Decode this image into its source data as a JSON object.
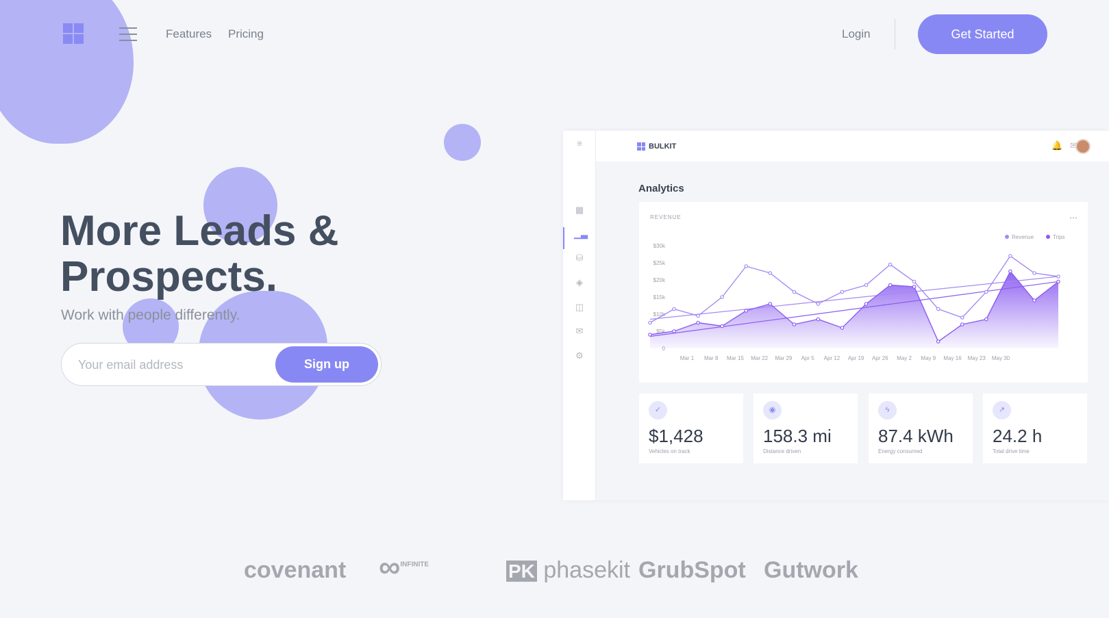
{
  "nav": {
    "links": [
      "Features",
      "Pricing"
    ],
    "login": "Login",
    "cta": "Get Started"
  },
  "hero": {
    "title_line1": "More Leads &",
    "title_line2": "Prospects.",
    "subtitle": "Work with people differently.",
    "email_placeholder": "Your email address",
    "signup": "Sign up"
  },
  "dashboard": {
    "brand": "BULKIT",
    "heading": "Analytics",
    "card_title": "REVENUE",
    "menu": "…",
    "stats": [
      {
        "icon": "check-icon",
        "glyph": "✓",
        "value": "$1,428",
        "label": "Vehicles on track"
      },
      {
        "icon": "location-pin-icon",
        "glyph": "◉",
        "value": "158.3 mi",
        "label": "Distance driven"
      },
      {
        "icon": "lightning-icon",
        "glyph": "ϟ",
        "value": "87.4 kWh",
        "label": "Energy consumed"
      },
      {
        "icon": "trend-icon",
        "glyph": "↗",
        "value": "24.2 h",
        "label": "Total drive time"
      }
    ]
  },
  "chart_data": {
    "type": "area",
    "title": "REVENUE",
    "categories": [
      "Mar 1",
      "Mar 8",
      "Mar 15",
      "Mar 22",
      "Mar 29",
      "Apr 5",
      "Apr 12",
      "Apr 19",
      "Apr 26",
      "May 2",
      "May 9",
      "May 16",
      "May 23",
      "May 30"
    ],
    "y_ticks": [
      "0",
      "$5k",
      "$10k",
      "$15k",
      "$20k",
      "$25k",
      "$30k"
    ],
    "ylim": [
      0,
      30000
    ],
    "legend_position": "top-right",
    "series": [
      {
        "name": "Revenue",
        "color": "#a48af4",
        "style": "line",
        "x": [
          0,
          1,
          2,
          3,
          4,
          5,
          6,
          7,
          8,
          9,
          10,
          11,
          12,
          13,
          14,
          15,
          16,
          17
        ],
        "values": [
          7500,
          11500,
          9500,
          15000,
          24000,
          22000,
          16500,
          13000,
          16500,
          18500,
          24500,
          19500,
          11500,
          9000,
          16500,
          27000,
          22000,
          21000
        ]
      },
      {
        "name": "Trips",
        "color": "#8a5cf0",
        "style": "area",
        "x": [
          0,
          1,
          2,
          3,
          4,
          5,
          6,
          7,
          8,
          9,
          10,
          11,
          12,
          13,
          14,
          15,
          16,
          17
        ],
        "values": [
          4000,
          5000,
          7500,
          6500,
          11000,
          13000,
          7000,
          8500,
          6000,
          13000,
          18500,
          18000,
          2000,
          7000,
          8500,
          22500,
          14000,
          19500
        ]
      }
    ],
    "trend_lines": [
      {
        "color": "#a48af4",
        "from": 8500,
        "to": 21000
      },
      {
        "color": "#8a5cf0",
        "from": 3500,
        "to": 19500
      }
    ]
  },
  "partners": [
    "covenant",
    "INFINITE",
    "phasekit",
    "GrubSpot",
    "Gutwork"
  ],
  "colors": {
    "accent": "#8888f4",
    "blob": "#b3b3f5",
    "text": "#444f60"
  }
}
